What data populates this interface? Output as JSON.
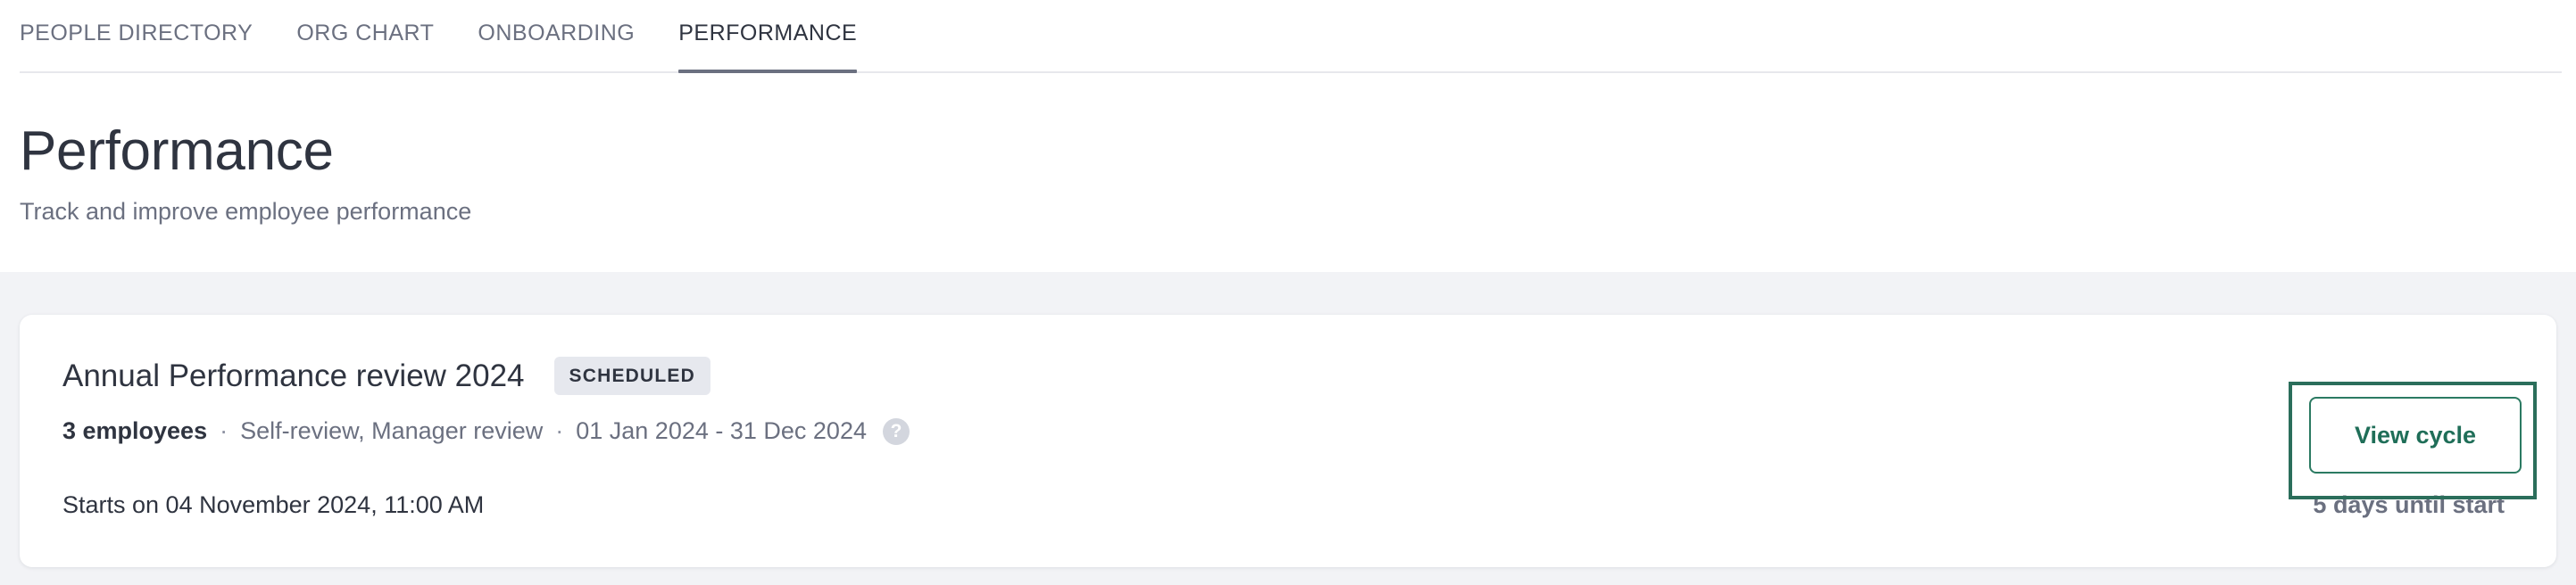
{
  "tabs": [
    {
      "label": "PEOPLE DIRECTORY",
      "active": false
    },
    {
      "label": "ORG CHART",
      "active": false
    },
    {
      "label": "ONBOARDING",
      "active": false
    },
    {
      "label": "PERFORMANCE",
      "active": true
    }
  ],
  "header": {
    "title": "Performance",
    "subtitle": "Track and improve employee performance"
  },
  "cycle": {
    "name": "Annual Performance review 2024",
    "status": "SCHEDULED",
    "employees": "3 employees",
    "review_types": "Self-review, Manager review",
    "date_range": "01 Jan 2024 - 31 Dec 2024",
    "help_icon": "question-circle-icon",
    "starts_on": "Starts on 04 November 2024, 11:00 AM",
    "days_until": "5 days until start",
    "view_button": "View cycle"
  },
  "colors": {
    "accent": "#1f6e58",
    "background": "#f2f3f6",
    "text_primary": "#2f3440",
    "text_secondary": "#6b7080"
  }
}
